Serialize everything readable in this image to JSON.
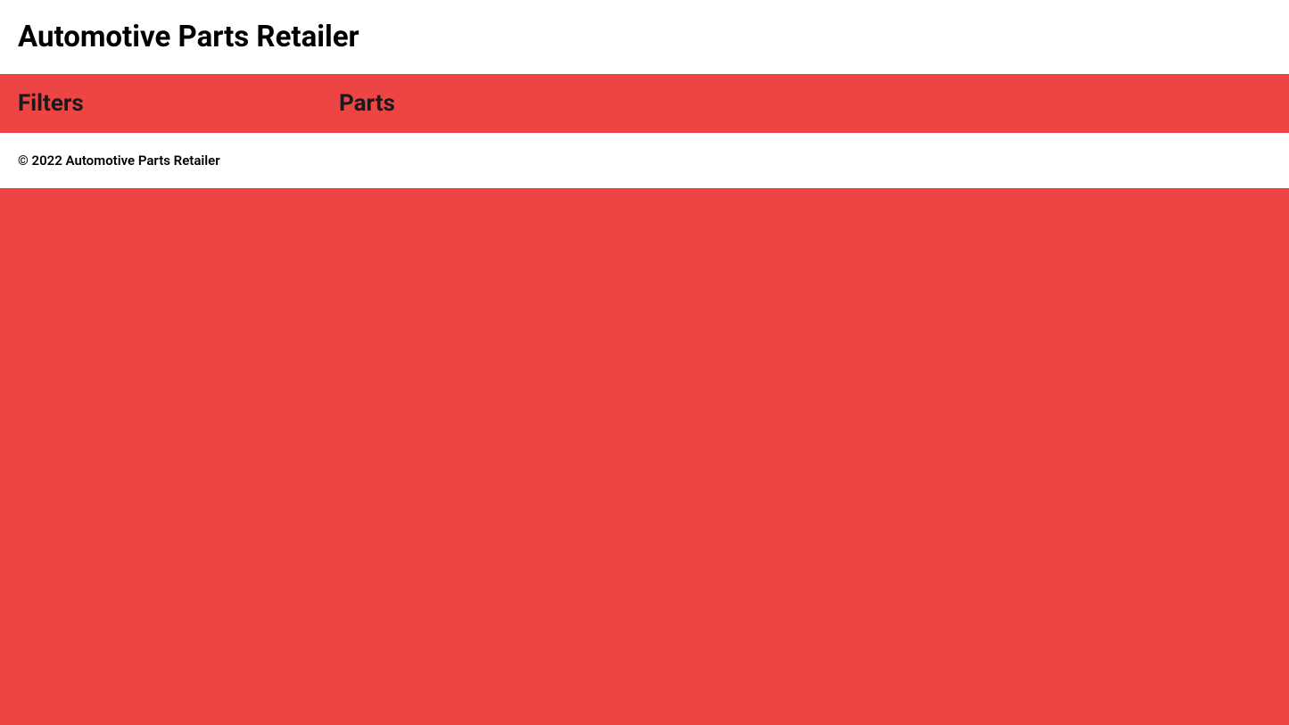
{
  "header": {
    "title": "Automotive Parts Retailer"
  },
  "sidebar": {
    "title": "Filters"
  },
  "content": {
    "title": "Parts"
  },
  "footer": {
    "copyright": "© 2022 Automotive Parts Retailer"
  },
  "colors": {
    "background": "#ef4444",
    "headerBg": "#ffffff",
    "footerBg": "#ffffff",
    "textDark": "#000000",
    "textMuted": "#1a1a1a"
  }
}
